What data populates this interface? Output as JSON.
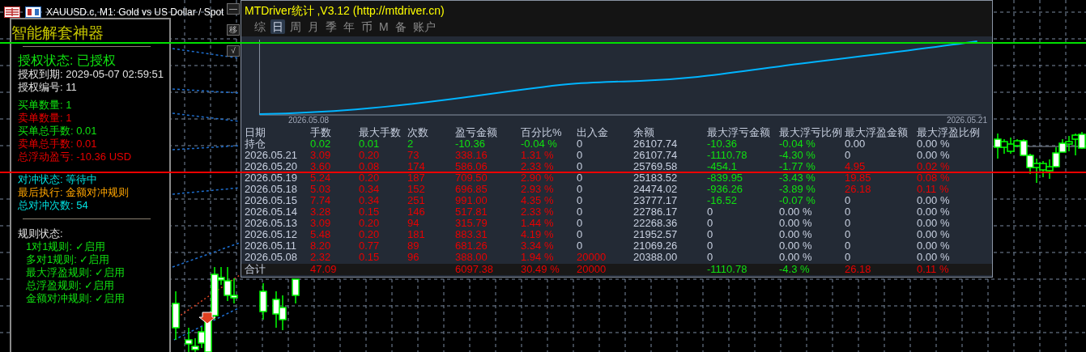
{
  "chart_window": {
    "symbol_title": "XAUUSD.c, M1:  Gold vs US Dollar / Spot"
  },
  "ea_panel": {
    "title": "智能解套神器",
    "buttons": [
      {
        "label": "—"
      },
      {
        "label": "移"
      },
      {
        "label": "√"
      }
    ],
    "license": [
      {
        "kind": "status",
        "text": "授权状态: 已授权",
        "color": "#10e010"
      },
      {
        "kind": "line",
        "text": "授权到期: 2029-05-07 02:59:51",
        "color": "#e0e0e0"
      },
      {
        "kind": "line",
        "text": "授权编号: 11",
        "color": "#e0e0e0"
      }
    ],
    "orders": [
      {
        "text": "买单数量: 1",
        "color": "#10e010"
      },
      {
        "text": "卖单数量: 1",
        "color": "#e80000"
      },
      {
        "text": "买单总手数: 0.01",
        "color": "#10e010"
      },
      {
        "text": "卖单总手数: 0.01",
        "color": "#e80000"
      },
      {
        "text": "总浮动盈亏: -10.36 USD",
        "color": "#e80000"
      }
    ],
    "hedge": [
      {
        "text": "对冲状态: 等待中",
        "color": "#00e0e0"
      },
      {
        "text": "最后执行: 金额对冲规则",
        "color": "#ffa500"
      },
      {
        "text": "总对冲次数: 54",
        "color": "#00e0e0"
      }
    ],
    "rules": {
      "title": "规则状态:",
      "children": [
        {
          "text": "1对1规则: ✓启用"
        },
        {
          "text": "多对1规则: ✓启用"
        },
        {
          "text": "最大浮盈规则: ✓启用"
        },
        {
          "text": "总浮盈规则: ✓启用"
        },
        {
          "text": "金额对冲规则: ✓启用"
        }
      ]
    }
  },
  "stats_window": {
    "title": "MTDriver统计 ,V3.12 (http://mtdriver.cn)",
    "tabs": [
      {
        "label": "综",
        "selected": false
      },
      {
        "label": "日",
        "selected": true
      },
      {
        "label": "周",
        "selected": false
      },
      {
        "label": "月",
        "selected": false
      },
      {
        "label": "季",
        "selected": false
      },
      {
        "label": "年",
        "selected": false
      },
      {
        "label": "币",
        "selected": false
      },
      {
        "label": "M",
        "selected": false
      },
      {
        "label": "备",
        "selected": false
      },
      {
        "label": "账户",
        "selected": false
      }
    ],
    "equity_chart": {
      "start_label": "2026.05.08",
      "end_label": "2026.05.21"
    },
    "table": {
      "columns": [
        "日期",
        "手数",
        "最大手数",
        "次数",
        "盈亏金额",
        "百分比%",
        "出入金",
        "余额",
        "最大浮亏金额",
        "最大浮亏比例",
        "最大浮盈金额",
        "最大浮盈比例"
      ],
      "rows": [
        {
          "cells": [
            {
              "text": "持仓",
              "color": "#c8d0e0"
            },
            {
              "text": "0.02",
              "color": "#10e010"
            },
            {
              "text": "0.01",
              "color": "#10e010"
            },
            {
              "text": "2",
              "color": "#10e010"
            },
            {
              "text": "-10.36",
              "color": "#10e010"
            },
            {
              "text": "-0.04 %",
              "color": "#10e010"
            },
            {
              "text": "0",
              "color": "#c8d0e0"
            },
            {
              "text": "26107.74",
              "color": "#c8d0e0"
            },
            {
              "text": "-10.36",
              "color": "#10e010"
            },
            {
              "text": "-0.04 %",
              "color": "#10e010"
            },
            {
              "text": "0.00",
              "color": "#c8d0e0"
            },
            {
              "text": "0.00 %",
              "color": "#c8d0e0"
            }
          ]
        },
        {
          "cells": [
            {
              "text": "2026.05.21",
              "color": "#c8d0e0"
            },
            {
              "text": "3.09",
              "color": "#e80000"
            },
            {
              "text": "0.20",
              "color": "#e80000"
            },
            {
              "text": "73",
              "color": "#e80000"
            },
            {
              "text": "338.16",
              "color": "#e80000"
            },
            {
              "text": "1.31 %",
              "color": "#e80000"
            },
            {
              "text": "0",
              "color": "#c8d0e0"
            },
            {
              "text": "26107.74",
              "color": "#c8d0e0"
            },
            {
              "text": "-1110.78",
              "color": "#10e010"
            },
            {
              "text": "-4.30 %",
              "color": "#10e010"
            },
            {
              "text": "0",
              "color": "#c8d0e0"
            },
            {
              "text": "0.00 %",
              "color": "#c8d0e0"
            }
          ]
        },
        {
          "cells": [
            {
              "text": "2026.05.20",
              "color": "#c8d0e0"
            },
            {
              "text": "3.60",
              "color": "#e80000"
            },
            {
              "text": "0.08",
              "color": "#e80000"
            },
            {
              "text": "174",
              "color": "#e80000"
            },
            {
              "text": "586.06",
              "color": "#e80000"
            },
            {
              "text": "2.33 %",
              "color": "#e80000"
            },
            {
              "text": "0",
              "color": "#c8d0e0"
            },
            {
              "text": "25769.58",
              "color": "#c8d0e0"
            },
            {
              "text": "-454.1",
              "color": "#10e010"
            },
            {
              "text": "-1.77 %",
              "color": "#10e010"
            },
            {
              "text": "4.95",
              "color": "#e80000"
            },
            {
              "text": "0.02 %",
              "color": "#e80000"
            }
          ]
        },
        {
          "cells": [
            {
              "text": "2026.05.19",
              "color": "#c8d0e0"
            },
            {
              "text": "5.24",
              "color": "#e80000"
            },
            {
              "text": "0.20",
              "color": "#e80000"
            },
            {
              "text": "187",
              "color": "#e80000"
            },
            {
              "text": "709.50",
              "color": "#e80000"
            },
            {
              "text": "2.90 %",
              "color": "#e80000"
            },
            {
              "text": "0",
              "color": "#c8d0e0"
            },
            {
              "text": "25183.52",
              "color": "#c8d0e0"
            },
            {
              "text": "-839.95",
              "color": "#10e010"
            },
            {
              "text": "-3.43 %",
              "color": "#10e010"
            },
            {
              "text": "19.85",
              "color": "#e80000"
            },
            {
              "text": "0.08 %",
              "color": "#e80000"
            }
          ]
        },
        {
          "cells": [
            {
              "text": "2026.05.18",
              "color": "#c8d0e0"
            },
            {
              "text": "5.03",
              "color": "#e80000"
            },
            {
              "text": "0.34",
              "color": "#e80000"
            },
            {
              "text": "152",
              "color": "#e80000"
            },
            {
              "text": "696.85",
              "color": "#e80000"
            },
            {
              "text": "2.93 %",
              "color": "#e80000"
            },
            {
              "text": "0",
              "color": "#c8d0e0"
            },
            {
              "text": "24474.02",
              "color": "#c8d0e0"
            },
            {
              "text": "-936.26",
              "color": "#10e010"
            },
            {
              "text": "-3.89 %",
              "color": "#10e010"
            },
            {
              "text": "26.18",
              "color": "#e80000"
            },
            {
              "text": "0.11 %",
              "color": "#e80000"
            }
          ]
        },
        {
          "cells": [
            {
              "text": "2026.05.15",
              "color": "#c8d0e0"
            },
            {
              "text": "7.74",
              "color": "#e80000"
            },
            {
              "text": "0.34",
              "color": "#e80000"
            },
            {
              "text": "251",
              "color": "#e80000"
            },
            {
              "text": "991.00",
              "color": "#e80000"
            },
            {
              "text": "4.35 %",
              "color": "#e80000"
            },
            {
              "text": "0",
              "color": "#c8d0e0"
            },
            {
              "text": "23777.17",
              "color": "#c8d0e0"
            },
            {
              "text": "-16.52",
              "color": "#10e010"
            },
            {
              "text": "-0.07 %",
              "color": "#10e010"
            },
            {
              "text": "0",
              "color": "#c8d0e0"
            },
            {
              "text": "0.00 %",
              "color": "#c8d0e0"
            }
          ]
        },
        {
          "cells": [
            {
              "text": "2026.05.14",
              "color": "#c8d0e0"
            },
            {
              "text": "3.28",
              "color": "#e80000"
            },
            {
              "text": "0.15",
              "color": "#e80000"
            },
            {
              "text": "146",
              "color": "#e80000"
            },
            {
              "text": "517.81",
              "color": "#e80000"
            },
            {
              "text": "2.33 %",
              "color": "#e80000"
            },
            {
              "text": "0",
              "color": "#c8d0e0"
            },
            {
              "text": "22786.17",
              "color": "#c8d0e0"
            },
            {
              "text": "0",
              "color": "#c8d0e0"
            },
            {
              "text": "0.00 %",
              "color": "#c8d0e0"
            },
            {
              "text": "0",
              "color": "#c8d0e0"
            },
            {
              "text": "0.00 %",
              "color": "#c8d0e0"
            }
          ]
        },
        {
          "cells": [
            {
              "text": "2026.05.13",
              "color": "#c8d0e0"
            },
            {
              "text": "3.09",
              "color": "#e80000"
            },
            {
              "text": "0.20",
              "color": "#e80000"
            },
            {
              "text": "94",
              "color": "#e80000"
            },
            {
              "text": "315.79",
              "color": "#e80000"
            },
            {
              "text": "1.44 %",
              "color": "#e80000"
            },
            {
              "text": "0",
              "color": "#c8d0e0"
            },
            {
              "text": "22268.36",
              "color": "#c8d0e0"
            },
            {
              "text": "0",
              "color": "#c8d0e0"
            },
            {
              "text": "0.00 %",
              "color": "#c8d0e0"
            },
            {
              "text": "0",
              "color": "#c8d0e0"
            },
            {
              "text": "0.00 %",
              "color": "#c8d0e0"
            }
          ]
        },
        {
          "cells": [
            {
              "text": "2026.05.12",
              "color": "#c8d0e0"
            },
            {
              "text": "5.48",
              "color": "#e80000"
            },
            {
              "text": "0.20",
              "color": "#e80000"
            },
            {
              "text": "181",
              "color": "#e80000"
            },
            {
              "text": "883.31",
              "color": "#e80000"
            },
            {
              "text": "4.19 %",
              "color": "#e80000"
            },
            {
              "text": "0",
              "color": "#c8d0e0"
            },
            {
              "text": "21952.57",
              "color": "#c8d0e0"
            },
            {
              "text": "0",
              "color": "#c8d0e0"
            },
            {
              "text": "0.00 %",
              "color": "#c8d0e0"
            },
            {
              "text": "0",
              "color": "#c8d0e0"
            },
            {
              "text": "0.00 %",
              "color": "#c8d0e0"
            }
          ]
        },
        {
          "cells": [
            {
              "text": "2026.05.11",
              "color": "#c8d0e0"
            },
            {
              "text": "8.20",
              "color": "#e80000"
            },
            {
              "text": "0.77",
              "color": "#e80000"
            },
            {
              "text": "89",
              "color": "#e80000"
            },
            {
              "text": "681.26",
              "color": "#e80000"
            },
            {
              "text": "3.34 %",
              "color": "#e80000"
            },
            {
              "text": "0",
              "color": "#c8d0e0"
            },
            {
              "text": "21069.26",
              "color": "#c8d0e0"
            },
            {
              "text": "0",
              "color": "#c8d0e0"
            },
            {
              "text": "0.00 %",
              "color": "#c8d0e0"
            },
            {
              "text": "0",
              "color": "#c8d0e0"
            },
            {
              "text": "0.00 %",
              "color": "#c8d0e0"
            }
          ]
        },
        {
          "cells": [
            {
              "text": "2026.05.08",
              "color": "#c8d0e0"
            },
            {
              "text": "2.32",
              "color": "#e80000"
            },
            {
              "text": "0.15",
              "color": "#e80000"
            },
            {
              "text": "96",
              "color": "#e80000"
            },
            {
              "text": "388.00",
              "color": "#e80000"
            },
            {
              "text": "1.94 %",
              "color": "#e80000"
            },
            {
              "text": "20000",
              "color": "#e80000"
            },
            {
              "text": "20388.00",
              "color": "#c8d0e0"
            },
            {
              "text": "0",
              "color": "#c8d0e0"
            },
            {
              "text": "0.00 %",
              "color": "#c8d0e0"
            },
            {
              "text": "0",
              "color": "#c8d0e0"
            },
            {
              "text": "0.00 %",
              "color": "#c8d0e0"
            }
          ]
        }
      ],
      "total": {
        "cells": [
          {
            "text": "合计",
            "color": "#c8d0e0"
          },
          {
            "text": "47.09",
            "color": "#e80000"
          },
          null,
          null,
          {
            "text": "6097.38",
            "color": "#e80000"
          },
          {
            "text": "30.49 %",
            "color": "#e80000"
          },
          {
            "text": "20000",
            "color": "#e80000"
          },
          null,
          {
            "text": "-1110.78",
            "color": "#10e010"
          },
          {
            "text": "-4.3 %",
            "color": "#10e010"
          },
          {
            "text": "26.18",
            "color": "#e80000"
          },
          {
            "text": "0.11 %",
            "color": "#e80000"
          }
        ]
      }
    }
  }
}
